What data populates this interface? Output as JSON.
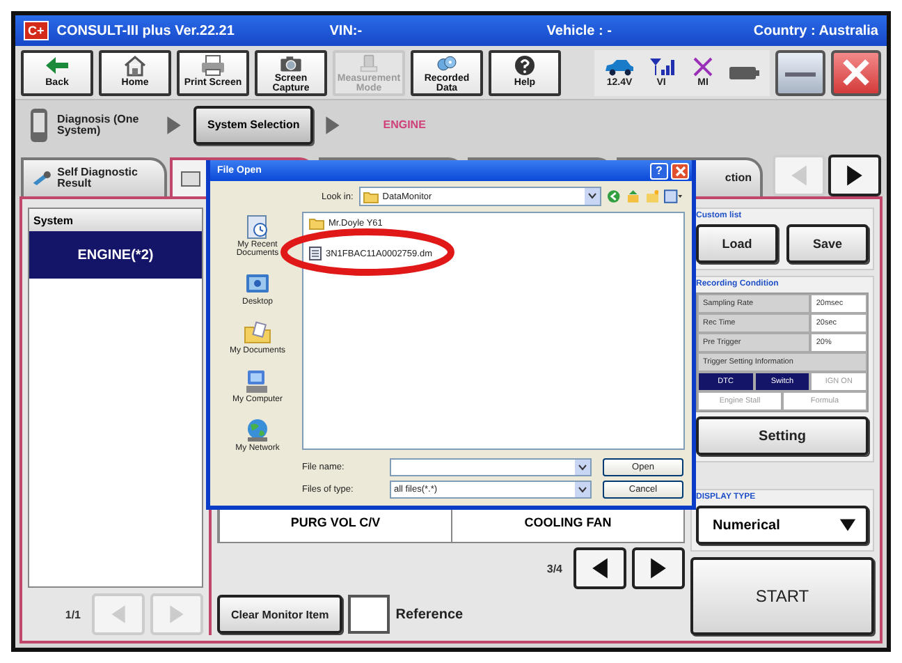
{
  "window": {
    "logo": "C+",
    "title": "CONSULT-III plus  Ver.22.21",
    "vin": "VIN:-",
    "vehicle": "Vehicle : -",
    "country": "Country : Australia"
  },
  "toolbar": [
    {
      "label": "Back",
      "kind": "back",
      "disabled": false
    },
    {
      "label": "Home",
      "kind": "home",
      "disabled": false
    },
    {
      "label": "Print Screen",
      "kind": "print",
      "disabled": false
    },
    {
      "label": "Screen Capture",
      "kind": "camera",
      "disabled": false
    },
    {
      "label": "Measurement Mode",
      "kind": "measure",
      "disabled": true
    },
    {
      "label": "Recorded Data",
      "kind": "recorded",
      "disabled": false
    },
    {
      "label": "Help",
      "kind": "help",
      "disabled": false
    }
  ],
  "status": [
    {
      "label": "12.4V",
      "kind": "car"
    },
    {
      "label": "VI",
      "kind": "signal"
    },
    {
      "label": "MI",
      "kind": "cross"
    },
    {
      "kind": "battery"
    }
  ],
  "breadcrumb": {
    "step": "Diagnosis (One System)",
    "current": "System Selection",
    "system": "ENGINE"
  },
  "tabs": [
    {
      "label": "Self Diagnostic Result",
      "selected": false
    },
    {
      "selected": true
    },
    {
      "selected": false
    },
    {
      "selected": false
    },
    {
      "label": "ction",
      "selected": false
    }
  ],
  "tab_nav": {
    "prev_disabled": true,
    "next_disabled": false
  },
  "system_list": {
    "header": "System",
    "items": [
      {
        "label": "ENGINE(*2)",
        "selected": true
      }
    ],
    "page": "1/1"
  },
  "monitor": {
    "items": [
      {
        "label": "PURG VOL C/V"
      },
      {
        "label": "COOLING FAN"
      }
    ],
    "page": "3/4",
    "clear_button": "Clear Monitor Item",
    "reference": {
      "label": "Reference",
      "checked": false
    }
  },
  "custom_list": {
    "title": "Custom list",
    "buttons": [
      "Load",
      "Save"
    ]
  },
  "recording": {
    "title": "Recording Condition",
    "rows": [
      {
        "label": "Sampling Rate",
        "value": "20msec"
      },
      {
        "label": "Rec Time",
        "value": "20sec"
      },
      {
        "label": "Pre Trigger",
        "value": "20%"
      }
    ],
    "trigger_title": "Trigger Setting Information",
    "triggers": [
      {
        "label": "DTC",
        "selected": true
      },
      {
        "label": "Switch",
        "selected": true
      },
      {
        "label": "IGN ON",
        "selected": false
      },
      {
        "label": "Engine Stall",
        "selected": false
      },
      {
        "label": "Formula",
        "selected": false
      }
    ]
  },
  "setting_button": "Setting",
  "display_type": {
    "title": "DISPLAY TYPE",
    "value": "Numerical"
  },
  "start_button": "START",
  "dialog": {
    "title": "File Open",
    "help": "?",
    "look_in_label": "Look in:",
    "look_in": "DataMonitor",
    "places": [
      {
        "label": "My Recent Documents",
        "kind": "recent"
      },
      {
        "label": "Desktop",
        "kind": "desktop"
      },
      {
        "label": "My Documents",
        "kind": "documents"
      },
      {
        "label": "My Computer",
        "kind": "computer"
      },
      {
        "label": "My Network",
        "kind": "network"
      }
    ],
    "files": [
      {
        "name": "Mr.Doyle Y61",
        "kind": "folder",
        "highlighted": false
      },
      {
        "name": "3N1FBAC11A0002759.dm",
        "kind": "file",
        "highlighted": true
      }
    ],
    "file_name_label": "File name:",
    "file_type_label": "Files of type:",
    "file_type": "all files(*.*)",
    "buttons": [
      "Open",
      "Cancel"
    ]
  }
}
